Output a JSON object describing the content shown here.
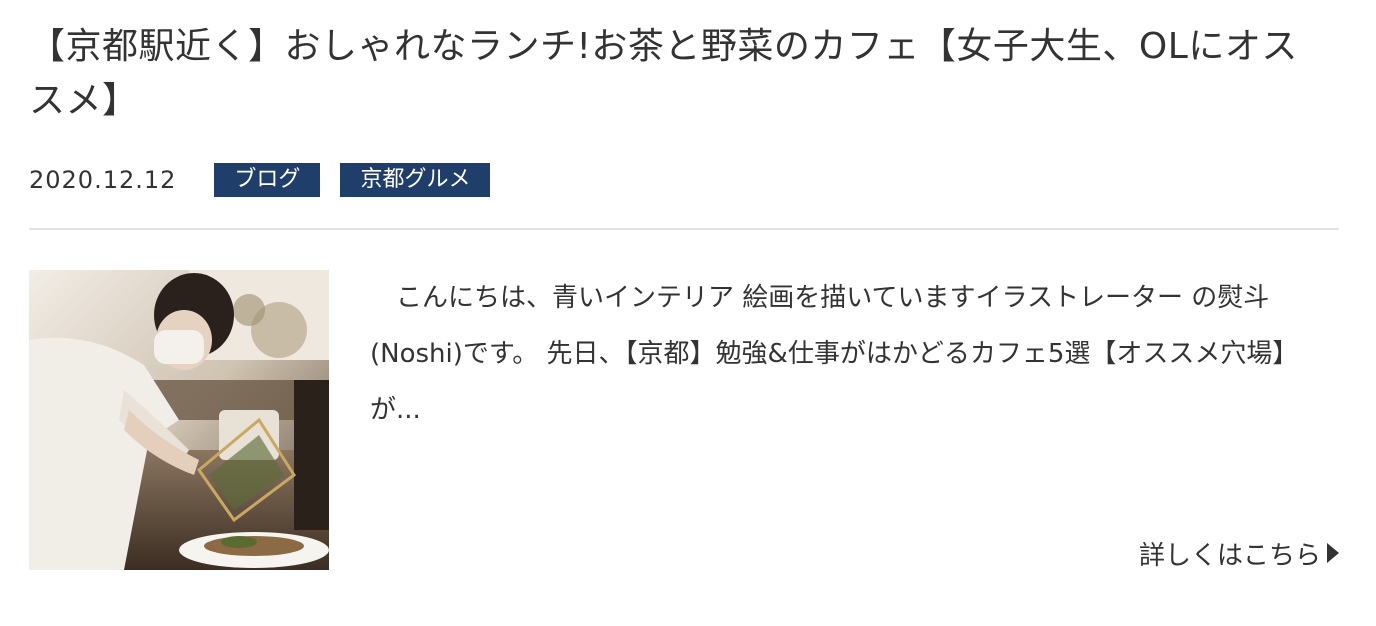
{
  "post": {
    "title": "【京都駅近く】おしゃれなランチ!お茶と野菜のカフェ【女子大生、OLにオススメ】",
    "date": "2020.12.12",
    "tags": [
      "ブログ",
      "京都グルメ"
    ],
    "thumbnail": {
      "icon": "cafe-staff-photo"
    },
    "excerpt": "　こんにちは、青いインテリア 絵画を描いていますイラストレーター の熨斗(Noshi)です。 先日、【京都】勉強&仕事がはかどるカフェ5選【オススメ穴場】が...",
    "read_more_label": "詳しくはこちら",
    "read_more_icon": "triangle-right-icon"
  },
  "colors": {
    "tag_background": "#1f3f6a",
    "tag_text": "#ffffff",
    "text": "#333333",
    "divider": "#e2e2e2"
  }
}
